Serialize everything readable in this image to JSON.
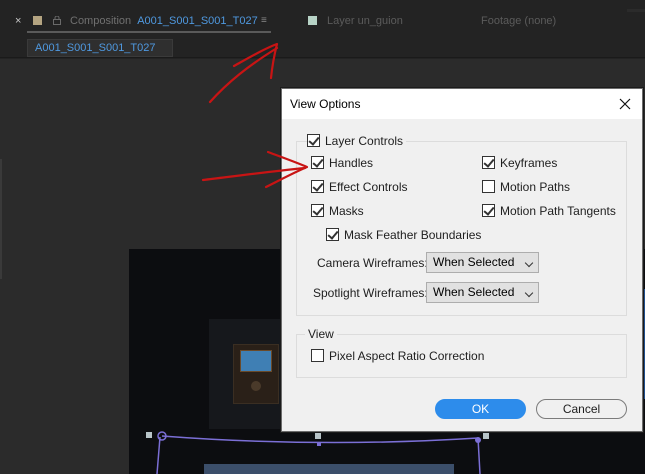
{
  "tabs": {
    "close_glyph": "×",
    "composition_label": "Composition",
    "composition_name": "A001_S001_S001_T027",
    "menu_glyph": "≡",
    "layer_label": "Layer un_guion",
    "footage_label": "Footage (none)"
  },
  "breadcrumb": {
    "active": "A001_S001_S001_T027"
  },
  "dialog": {
    "title": "View Options",
    "layer_controls": {
      "label": "Layer Controls",
      "checked": true
    },
    "options": [
      {
        "label": "Handles",
        "checked": true
      },
      {
        "label": "Keyframes",
        "checked": true
      },
      {
        "label": "Effect Controls",
        "checked": true
      },
      {
        "label": "Motion Paths",
        "checked": false
      },
      {
        "label": "Masks",
        "checked": true
      },
      {
        "label": "Motion Path Tangents",
        "checked": true
      },
      {
        "label": "Mask Feather Boundaries",
        "checked": true
      }
    ],
    "camera_wireframes": {
      "label": "Camera Wireframes:",
      "value": "When Selected"
    },
    "spotlight_wireframes": {
      "label": "Spotlight Wireframes:",
      "value": "When Selected"
    },
    "view_group": {
      "label": "View",
      "pixel_aspect": {
        "label": "Pixel Aspect Ratio Correction",
        "checked": false
      }
    },
    "ok_label": "OK",
    "cancel_label": "Cancel"
  },
  "colors": {
    "accent_blue": "#4f99e0",
    "ok_button": "#2d8ceb",
    "annotation_red": "#c81414",
    "mask_path": "#7b6fd6"
  },
  "icons": [
    "close-icon",
    "lock-icon",
    "panel-menu-icon",
    "dialog-close-icon",
    "dropdown-caret-icon",
    "checkmark-icon"
  ]
}
